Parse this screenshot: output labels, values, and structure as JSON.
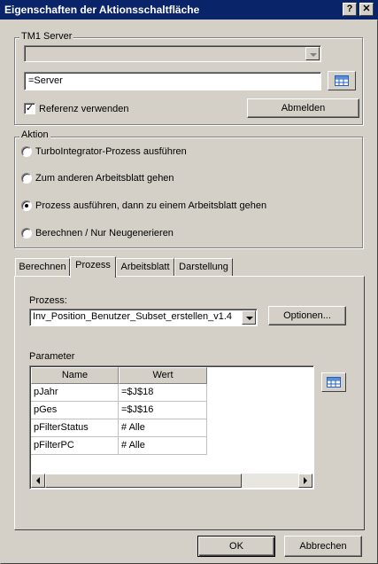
{
  "window": {
    "title": "Eigenschaften der Aktionsschaltfläche",
    "help_glyph": "?",
    "close_glyph": "✕"
  },
  "server_group": {
    "legend": "TM1 Server",
    "server_value": "=Server",
    "use_reference_label": "Referenz verwenden",
    "use_reference_checked": true,
    "logout_label": "Abmelden"
  },
  "action_group": {
    "legend": "Aktion",
    "options": [
      {
        "label": "TurboIntegrator-Prozess ausführen",
        "selected": false
      },
      {
        "label": "Zum anderen Arbeitsblatt gehen",
        "selected": false
      },
      {
        "label": "Prozess ausführen, dann zu einem Arbeitsblatt gehen",
        "selected": true
      },
      {
        "label": "Berechnen / Nur Neugenerieren",
        "selected": false
      }
    ]
  },
  "tabs": [
    {
      "label": "Berechnen",
      "active": false
    },
    {
      "label": "Prozess",
      "active": true
    },
    {
      "label": "Arbeitsblatt",
      "active": false
    },
    {
      "label": "Darstellung",
      "active": false
    }
  ],
  "process_tab": {
    "process_label": "Prozess:",
    "process_value": "Inv_Position_Benutzer_Subset_erstellen_v1.4",
    "options_label": "Optionen...",
    "parameters_label": "Parameter",
    "columns": [
      "Name",
      "Wert"
    ],
    "rows": [
      {
        "name": "pJahr",
        "value": "=$J$18"
      },
      {
        "name": "pGes",
        "value": "=$J$16"
      },
      {
        "name": "pFilterStatus",
        "value": "# Alle"
      },
      {
        "name": "pFilterPC",
        "value": "# Alle"
      }
    ]
  },
  "footer": {
    "ok_label": "OK",
    "cancel_label": "Abbrechen"
  }
}
